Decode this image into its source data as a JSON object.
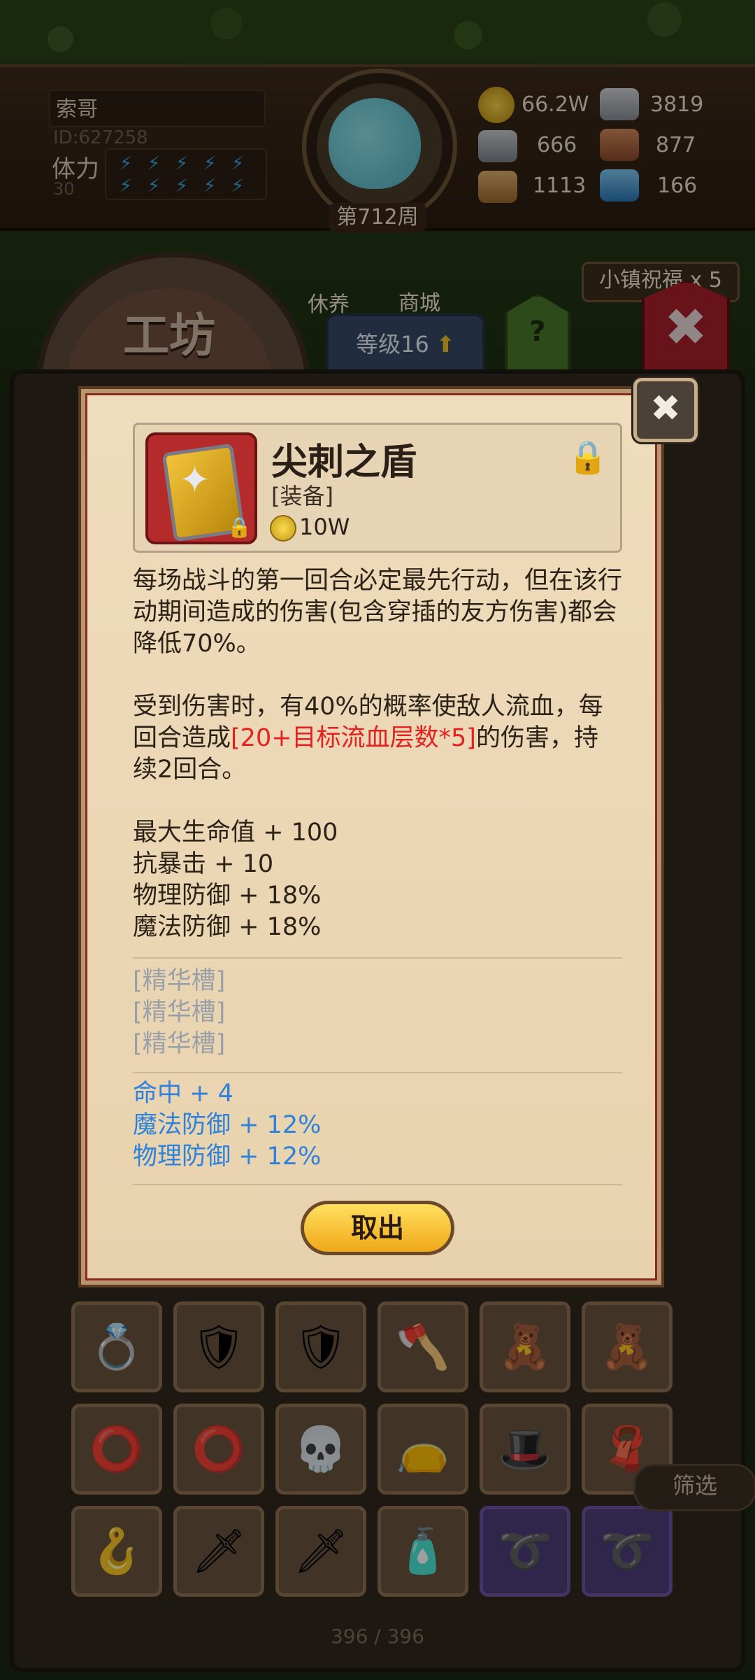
{
  "player": {
    "name": "索哥",
    "id": "ID:627258",
    "stamina_label": "体力",
    "stamina_value": "30",
    "week": "第712周"
  },
  "resources": [
    {
      "icon": "gold-coin-icon",
      "value": "66.2W"
    },
    {
      "icon": "iron-bar-icon",
      "value": "3819"
    },
    {
      "icon": "stone-icon",
      "value": "666"
    },
    {
      "icon": "leather-icon",
      "value": "877"
    },
    {
      "icon": "wood-log-icon",
      "value": "1113"
    },
    {
      "icon": "crystal-icon",
      "value": "166"
    }
  ],
  "town": {
    "rest_label": "休养",
    "shop_label": "商城",
    "blessing": "小镇祝福 x 5"
  },
  "workshop": {
    "title": "工坊",
    "level_tab": "等级16",
    "help": "?"
  },
  "item": {
    "name": "尖刺之盾",
    "type": "[装备]",
    "price": "10W",
    "desc1": "每场战斗的第一回合必定最先行动，但在该行动期间造成的伤害(包含穿插的友方伤害)都会降低70%。",
    "desc2_before": "受到伤害时，有40%的概率使敌人流血，每回合造成",
    "desc2_red": "[20+目标流血层数*5]",
    "desc2_after": "的伤害，持续2回合。",
    "stats": [
      "最大生命值 + 100",
      "抗暴击 + 10",
      "物理防御 + 18%",
      "魔法防御 + 18%"
    ],
    "sockets": [
      "[精华槽]",
      "[精华槽]",
      "[精华槽]"
    ],
    "bonus": [
      "命中 + 4",
      "魔法防御 + 12%",
      "物理防御 + 12%"
    ],
    "take_out": "取出"
  },
  "inventory": {
    "filter": "筛选",
    "counter": "396 / 396",
    "slots": [
      {
        "name": "ring-icon",
        "glyph": "💍",
        "purple": false
      },
      {
        "name": "blue-armor-icon",
        "glyph": "🛡",
        "purple": false
      },
      {
        "name": "blue-armor-icon",
        "glyph": "🛡",
        "purple": false
      },
      {
        "name": "axe-icon",
        "glyph": "🪓",
        "purple": false
      },
      {
        "name": "voodoo-doll-icon",
        "glyph": "🧸",
        "purple": false
      },
      {
        "name": "voodoo-doll-icon",
        "glyph": "🧸",
        "purple": false
      },
      {
        "name": "gold-ring-icon",
        "glyph": "⭕",
        "purple": false
      },
      {
        "name": "gold-ring-icon",
        "glyph": "⭕",
        "purple": false
      },
      {
        "name": "skull-staff-icon",
        "glyph": "💀",
        "purple": false
      },
      {
        "name": "pouch-icon",
        "glyph": "👝",
        "purple": false
      },
      {
        "name": "wizard-hat-icon",
        "glyph": "🎩",
        "purple": false
      },
      {
        "name": "red-cloth-icon",
        "glyph": "🧣",
        "purple": false
      },
      {
        "name": "hook-staff-icon",
        "glyph": "🪝",
        "purple": false
      },
      {
        "name": "sword-icon",
        "glyph": "🗡",
        "purple": false
      },
      {
        "name": "sword-icon",
        "glyph": "🗡",
        "purple": false
      },
      {
        "name": "potion-bottle-icon",
        "glyph": "🧴",
        "purple": false
      },
      {
        "name": "whip-icon",
        "glyph": "➰",
        "purple": true
      },
      {
        "name": "whip-icon",
        "glyph": "➰",
        "purple": true
      }
    ]
  }
}
